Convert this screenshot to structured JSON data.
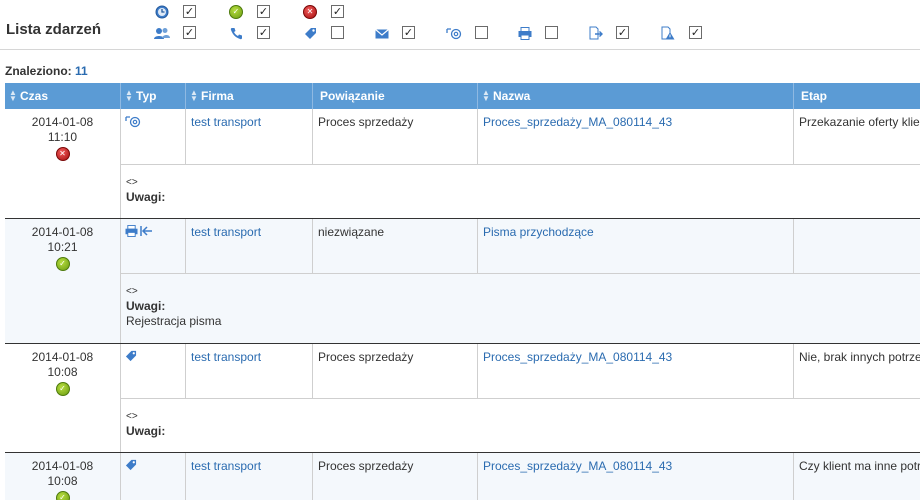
{
  "page": {
    "title": "Lista zdarzeń"
  },
  "filters": [
    {
      "icon": "clock-icon",
      "label": "Filtr: zegar",
      "checked": true
    },
    {
      "icon": "check-status-icon",
      "label": "Filtr: zakończone",
      "checked": true
    },
    {
      "icon": "error-status-icon",
      "label": "Filtr: anulowane",
      "checked": true
    },
    {
      "icon": "users-icon",
      "label": "Filtr: spotkanie",
      "checked": true
    },
    {
      "icon": "phone-icon",
      "label": "Filtr: telefon",
      "checked": true
    },
    {
      "icon": "tag-icon",
      "label": "Filtr: zadanie",
      "checked": false
    },
    {
      "icon": "mail-icon",
      "label": "Filtr: e-mail",
      "checked": true
    },
    {
      "icon": "email-at-icon",
      "label": "Filtr: email przychodzący",
      "checked": false
    },
    {
      "icon": "printer-icon",
      "label": "Filtr: pismo",
      "checked": false
    },
    {
      "icon": "document-export-icon",
      "label": "Filtr: dokument",
      "checked": true
    },
    {
      "icon": "warning-document-icon",
      "label": "Filtr: ostrzeżenie",
      "checked": true
    }
  ],
  "summary": {
    "found_label": "Znaleziono:",
    "found_count": "11"
  },
  "columns": {
    "czas": "Czas",
    "typ": "Typ",
    "firma": "Firma",
    "powiazanie": "Powiązanie",
    "nazwa": "Nazwa",
    "etap": "Etap"
  },
  "events": [
    {
      "date": "2014-01-08",
      "time": "11:10",
      "status": "error",
      "type_icons": [
        "email-at-icon"
      ],
      "firma": "test transport",
      "powiazanie": "Proces sprzedaży",
      "nazwa": "Proces_sprzedaży_MA_080114_43",
      "etap": "Przekazanie oferty klie",
      "arrows": "<>",
      "uwagi_label": "Uwagi:",
      "uwagi_text": ""
    },
    {
      "date": "2014-01-08",
      "time": "10:21",
      "status": "ok",
      "type_icons": [
        "printer-icon",
        "incoming-arrow-icon"
      ],
      "firma": "test transport",
      "powiazanie": "niezwiązane",
      "nazwa": "Pisma przychodzące",
      "etap": "",
      "arrows": "<>",
      "uwagi_label": "Uwagi:",
      "uwagi_text": "Rejestracja pisma"
    },
    {
      "date": "2014-01-08",
      "time": "10:08",
      "status": "ok",
      "type_icons": [
        "tag-icon"
      ],
      "firma": "test transport",
      "powiazanie": "Proces sprzedaży",
      "nazwa": "Proces_sprzedaży_MA_080114_43",
      "etap": "Nie, brak innych potrze",
      "arrows": "<>",
      "uwagi_label": "Uwagi:",
      "uwagi_text": ""
    },
    {
      "date": "2014-01-08",
      "time": "10:08",
      "status": "ok",
      "type_icons": [
        "tag-icon"
      ],
      "firma": "test transport",
      "powiazanie": "Proces sprzedaży",
      "nazwa": "Proces_sprzedaży_MA_080114_43",
      "etap": "Czy klient ma inne potr",
      "arrows": "",
      "uwagi_label": "",
      "uwagi_text": ""
    }
  ]
}
